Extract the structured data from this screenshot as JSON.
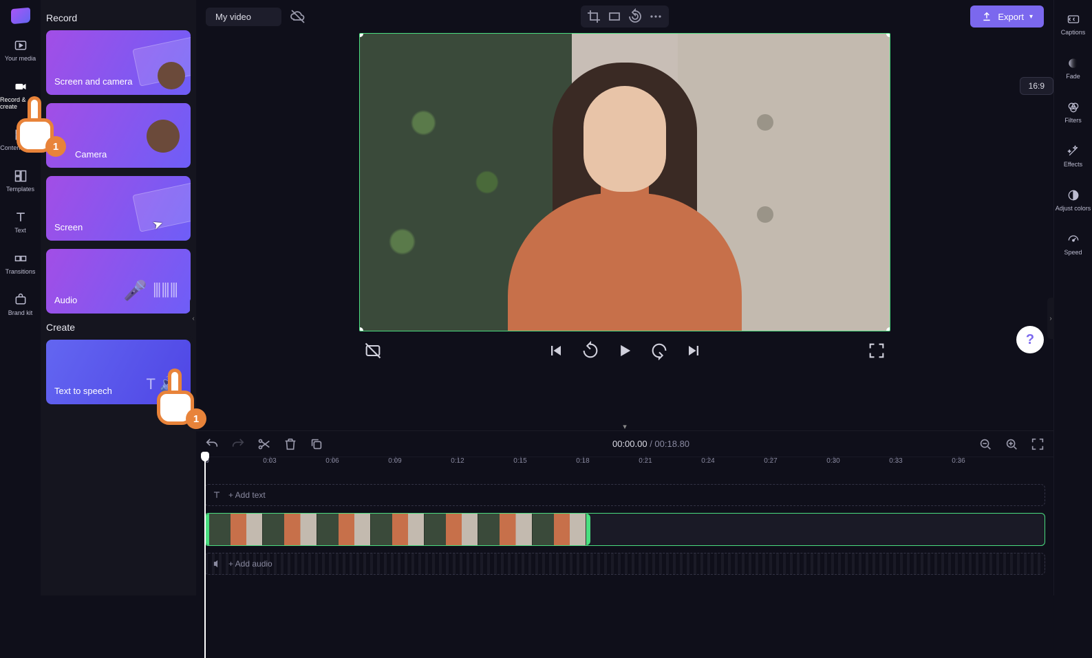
{
  "header": {
    "title": "My video",
    "export_label": "Export",
    "aspect_ratio": "16:9"
  },
  "left_nav": [
    {
      "id": "your-media",
      "label": "Your media"
    },
    {
      "id": "record-create",
      "label": "Record & create"
    },
    {
      "id": "content-library",
      "label": "Content library"
    },
    {
      "id": "templates",
      "label": "Templates"
    },
    {
      "id": "text",
      "label": "Text"
    },
    {
      "id": "transitions",
      "label": "Transitions"
    },
    {
      "id": "brand-kit",
      "label": "Brand kit"
    }
  ],
  "side_panel": {
    "section1_title": "Record",
    "cards_record": [
      {
        "id": "screen-camera",
        "label": "Screen and camera"
      },
      {
        "id": "camera",
        "label": "Camera"
      },
      {
        "id": "screen",
        "label": "Screen"
      },
      {
        "id": "audio",
        "label": "Audio"
      }
    ],
    "section2_title": "Create",
    "cards_create": [
      {
        "id": "text-to-speech",
        "label": "Text to speech"
      }
    ]
  },
  "right_nav": [
    {
      "id": "captions",
      "label": "Captions"
    },
    {
      "id": "fade",
      "label": "Fade"
    },
    {
      "id": "filters",
      "label": "Filters"
    },
    {
      "id": "effects",
      "label": "Effects"
    },
    {
      "id": "adjust-colors",
      "label": "Adjust colors"
    },
    {
      "id": "speed",
      "label": "Speed"
    }
  ],
  "playback": {
    "current_time": "00:00.00",
    "separator": " / ",
    "duration": "00:18.80"
  },
  "ruler_ticks": [
    "0",
    "0:03",
    "0:06",
    "0:09",
    "0:12",
    "0:15",
    "0:18",
    "0:21",
    "0:24",
    "0:27",
    "0:30",
    "0:33",
    "0:36"
  ],
  "tracks": {
    "add_text": "+ Add text",
    "add_audio": "+ Add audio"
  },
  "tutorial_step": "1",
  "help_label": "?"
}
